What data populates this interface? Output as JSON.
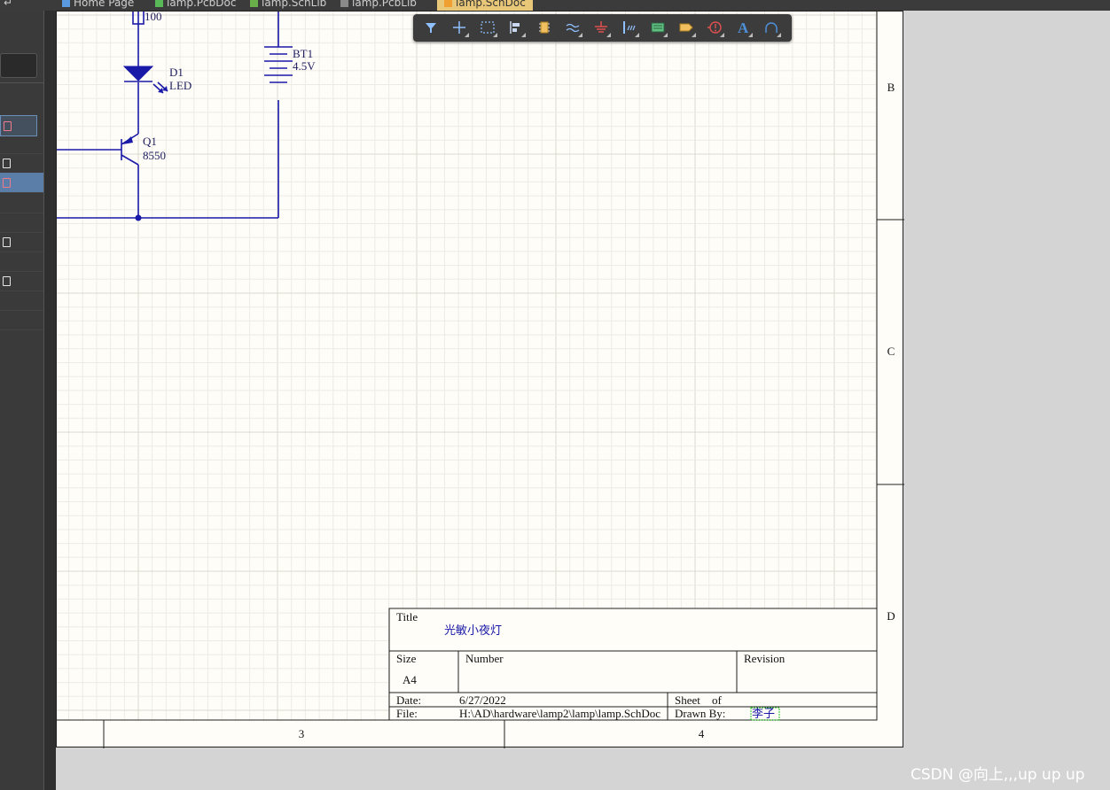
{
  "tabs": [
    {
      "label": "Home Page"
    },
    {
      "label": "lamp.PcbDoc"
    },
    {
      "label": "lamp.SchLib"
    },
    {
      "label": "lamp.PcbLib"
    },
    {
      "label": "lamp.SchDoc"
    }
  ],
  "toolbar": {
    "tools": [
      {
        "icon": "filter-icon",
        "color": "#8fc0ff"
      },
      {
        "icon": "crosshair-icon",
        "color": "#8fc0ff"
      },
      {
        "icon": "select-rect-icon",
        "color": "#8fc0ff"
      },
      {
        "icon": "align-icon",
        "color": "#c8d8f0"
      },
      {
        "icon": "part-icon",
        "color": "#f0c060"
      },
      {
        "icon": "bus-icon",
        "color": "#8fc0ff"
      },
      {
        "icon": "ground-icon",
        "color": "#e05050"
      },
      {
        "icon": "harness-icon",
        "color": "#8fc0ff"
      },
      {
        "icon": "sheet-symbol-icon",
        "color": "#60c080"
      },
      {
        "icon": "port-icon",
        "color": "#f0c060"
      },
      {
        "icon": "directive-icon",
        "color": "#e05050"
      },
      {
        "icon": "text-icon",
        "color": "#4f8fd8"
      },
      {
        "icon": "arc-icon",
        "color": "#4f8fd8"
      }
    ],
    "text_tool_glyph": "A"
  },
  "schematic": {
    "r_value": "100",
    "d1_designator": "D1",
    "d1_comment": "LED",
    "bt1_designator": "BT1",
    "bt1_comment": "4.5V",
    "q1_designator": "Q1",
    "q1_comment": "8550"
  },
  "zones": {
    "rows": [
      "B",
      "C",
      "D"
    ],
    "columns": [
      "3",
      "4"
    ]
  },
  "title_block": {
    "title_label": "Title",
    "title_value": "光敏小夜灯",
    "size_label": "Size",
    "size_value": "A4",
    "number_label": "Number",
    "revision_label": "Revision",
    "date_label": "Date:",
    "date_value": "6/27/2022",
    "sheet_label": "Sheet",
    "of_label": "of",
    "file_label": "File:",
    "file_value": "H:\\AD\\hardware\\lamp2\\lamp\\lamp.SchDoc",
    "drawn_by_label": "Drawn By:",
    "drawn_by_value": "李子"
  },
  "watermark": "CSDN @向上,,,up up up"
}
